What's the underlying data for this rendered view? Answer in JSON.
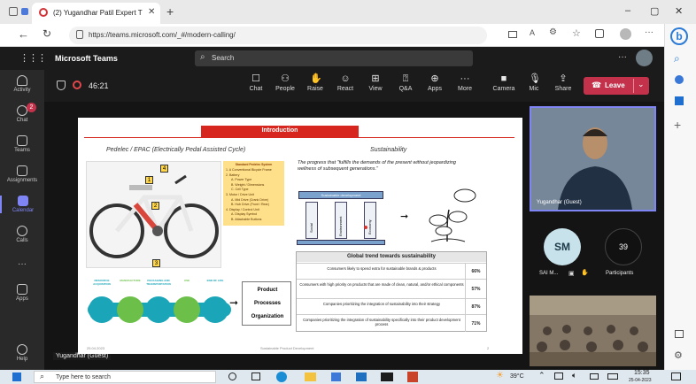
{
  "browser": {
    "tab_title": "(2) Yugandhar Patil Expert T",
    "url": "https://teams.microsoft.com/_#/modern-calling/",
    "window_controls": [
      "–",
      "▢",
      "✕"
    ]
  },
  "teams": {
    "app_name": "Microsoft Teams",
    "search_placeholder": "Search",
    "more": "···"
  },
  "rail": [
    {
      "icon": "bell-icon",
      "label": "Activity"
    },
    {
      "icon": "chat-icon",
      "label": "Chat",
      "badge": "2"
    },
    {
      "icon": "teams-icon",
      "label": "Teams"
    },
    {
      "icon": "assignments-icon",
      "label": "Assignments"
    },
    {
      "icon": "calendar-icon",
      "label": "Calendar"
    },
    {
      "icon": "calls-icon",
      "label": "Calls"
    },
    {
      "icon": "more-icon",
      "label": "···"
    },
    {
      "icon": "apps-icon",
      "label": "Apps"
    },
    {
      "icon": "help-icon",
      "label": "Help"
    }
  ],
  "call": {
    "timer": "46:21",
    "tools": [
      {
        "icon": "chat-icon",
        "label": "Chat"
      },
      {
        "icon": "people-icon",
        "label": "People"
      },
      {
        "icon": "raise-hand-icon",
        "label": "Raise"
      },
      {
        "icon": "react-icon",
        "label": "React"
      },
      {
        "icon": "view-icon",
        "label": "View"
      },
      {
        "icon": "qa-icon",
        "label": "Q&A"
      },
      {
        "icon": "apps-icon",
        "label": "Apps"
      },
      {
        "icon": "more-icon",
        "label": "More"
      }
    ],
    "device_tools": [
      {
        "icon": "camera-icon",
        "label": "Camera"
      },
      {
        "icon": "mic-icon",
        "label": "Mic"
      },
      {
        "icon": "share-icon",
        "label": "Share"
      }
    ],
    "leave_label": "Leave"
  },
  "participants": {
    "presenter_name": "Yugandhar (Guest)",
    "sai_initials": "SM",
    "sai_label": "SAI M...",
    "participant_count": "39",
    "participants_label": "Participants",
    "stage_label": "Yugandhar (Guest)"
  },
  "slide": {
    "title": "Introduction",
    "left_heading": "Pedelec / EPAC (Electrically Pedal Assisted Cycle)",
    "right_heading": "Sustainability",
    "quote": "The progress that \"fulfills the demands of the present without jeopardizing wellness of subsequent generations.\"",
    "legend_title": "Standard Pedelec System",
    "legend_items": [
      "1. A Conventional Bicycle Frame",
      "2. Battery",
      "A. Power Type",
      "B. Weight / Dimensions",
      "C. Cell Type",
      "3. Motor / Drive Unit",
      "A. Mid Drive (Crank Drive)",
      "B. Hub Drive (Front / Rear)",
      "4. Display / Control Unit",
      "A. Display Symbol",
      "B. Attachable Buttons"
    ],
    "callouts": [
      "1",
      "2",
      "3",
      "4"
    ],
    "process_steps": [
      "RESOURCE ACQUISITION",
      "MANUFACTURE",
      "PACKAGING AND TRANSPORTATION",
      "USE",
      "END OF LIFE"
    ],
    "flow_boxes": [
      "Product",
      "Processes",
      "Organization"
    ],
    "pillars_title": "Sustainable development",
    "pillars": [
      "Social",
      "Environment",
      "Economy"
    ],
    "trend_title": "Global trend towards sustainability",
    "trend_rows": [
      {
        "text": "Consumers likely to spend extra for sustainable brands & products",
        "value": "66%"
      },
      {
        "text": "Consumers with high priority on products that are made of clean, natural, and/or ethical components",
        "value": "57%"
      },
      {
        "text": "Companies prioritizing the integration of sustainability into their strategy",
        "value": "87%"
      },
      {
        "text": "Companies prioritizing the integration of sustainability specifically into their product development process",
        "value": "71%"
      }
    ],
    "footer_date": "25.04.2023",
    "footer_center": "Sustainable Product Development",
    "footer_page": "2"
  },
  "taskbar": {
    "search_placeholder": "Type here to search",
    "weather": "39°C",
    "time": "15:35",
    "date": "25-04-2023"
  }
}
